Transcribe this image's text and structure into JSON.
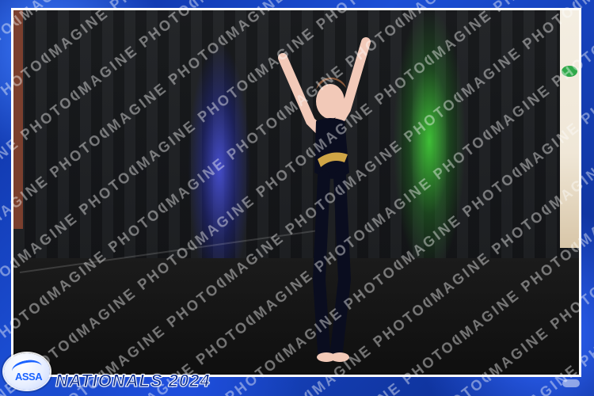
{
  "image": {
    "frame_color": "#1c4fd6",
    "border_color": "#ffffff",
    "stage_colors": {
      "curtain": "#15171a",
      "floor": "#0f0f0f",
      "blue_light": "#3d49ff",
      "green_light": "#46dc3c"
    },
    "subject": {
      "description": "young gymnast with arms raised on stage",
      "leotard_color": "#0a0d1f",
      "accent_color": "#f2c14e",
      "skin_color": "#f2c9b8"
    }
  },
  "watermark": {
    "text": "IMAGINE PHOTOGRAPHY",
    "color": "#ffffff"
  },
  "branding": {
    "logo_text": "ASSA",
    "event_title": "NATIONALS 2024"
  }
}
